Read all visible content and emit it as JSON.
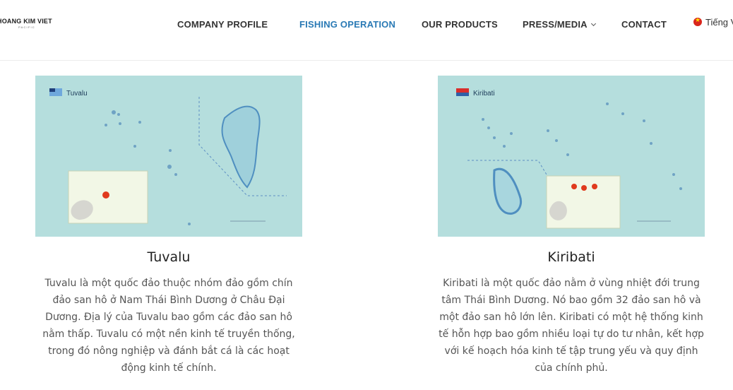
{
  "header": {
    "logo_text": "HOANG KIM VIET",
    "logo_sub": "PACIFIC",
    "nav": [
      {
        "label": "COMPANY PROFILE"
      },
      {
        "label": "FISHING OPERATION",
        "active": true
      },
      {
        "label": "OUR PRODUCTS"
      },
      {
        "label": "PRESS/MEDIA",
        "has_dropdown": true
      },
      {
        "label": "CONTACT"
      }
    ],
    "language": "Tiếng V"
  },
  "cards": [
    {
      "map_label": "Tuvalu",
      "title": "Tuvalu",
      "description": "Tuvalu là một quốc đảo thuộc nhóm đảo gồm chín đảo san hô ở Nam Thái Bình Dương ở Châu Đại Dương. Địa lý của Tuvalu bao gồm các đảo san hô nằm thấp. Tuvalu có một nền kinh tế truyền thống, trong đó nông nghiệp và đánh bắt cá là các hoạt động kinh tế chính."
    },
    {
      "map_label": "Kiribati",
      "title": "Kiribati",
      "description": "Kiribati là một quốc đảo nằm ở vùng nhiệt đới trung tâm Thái Bình Dương. Nó bao gồm 32 đảo san hô và một đảo san hô lớn lên. Kiribati có một hệ thống kinh tế hỗn hợp bao gồm nhiều loại tự do tư nhân, kết hợp với kế hoạch hóa kinh tế tập trung yếu và quy định của chính phủ."
    }
  ],
  "colors": {
    "nav_active": "#2a7ab5",
    "map_water": "#b5dedd",
    "marker": "#e03a1e"
  }
}
